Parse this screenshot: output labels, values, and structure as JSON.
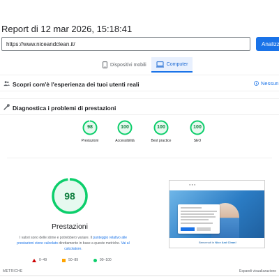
{
  "header": {
    "report_title": "Report di 12 mar 2026, 15:18:41"
  },
  "url_bar": {
    "value": "https://www.niceandclean.it/",
    "analyze_label": "Analizza"
  },
  "device_tabs": [
    {
      "label": "Dispositivi mobili",
      "icon": "smartphone-icon",
      "active": false
    },
    {
      "label": "Computer",
      "icon": "desktop-icon",
      "active": true
    }
  ],
  "sections": {
    "real_users": {
      "label": "Scopri com'è l'esperienza dei tuoi utenti reali",
      "no_data": "Nessun d"
    },
    "diagnostics": {
      "label": "Diagnostica i problemi di prestazioni"
    }
  },
  "scores": [
    {
      "name": "Prestazioni",
      "value": "98"
    },
    {
      "name": "Accessibilità",
      "value": "100"
    },
    {
      "name": "Best practice",
      "value": "100"
    },
    {
      "name": "SEO",
      "value": "100"
    }
  ],
  "performance": {
    "score": "98",
    "title": "Prestazioni",
    "disclaimer_part1": "I valori sono delle stime e potrebbero variare. Il ",
    "disclaimer_link1": "punteggio relativo alle prestazioni viene calcolato",
    "disclaimer_part2": " direttamente in base a queste metriche. ",
    "disclaimer_link2": "Vai al calcolatore."
  },
  "legend": [
    {
      "shape": "triangle",
      "range": "0–49",
      "color": "#cc0000"
    },
    {
      "shape": "square",
      "range": "50–89",
      "color": "#ffa400"
    },
    {
      "shape": "circle",
      "range": "90–100",
      "color": "#0cce6b"
    }
  ],
  "footer": {
    "metrics_label": "METRICHE",
    "expand_label": "Espandi visualizzazione"
  },
  "thumbnail": {
    "caption_prefix": "Benvenuti in ",
    "caption_brand": "Nice And Clean!"
  },
  "colors": {
    "accent": "#1a73e8",
    "pass": "#0cce6b",
    "pass_text": "#0c7d3c"
  }
}
